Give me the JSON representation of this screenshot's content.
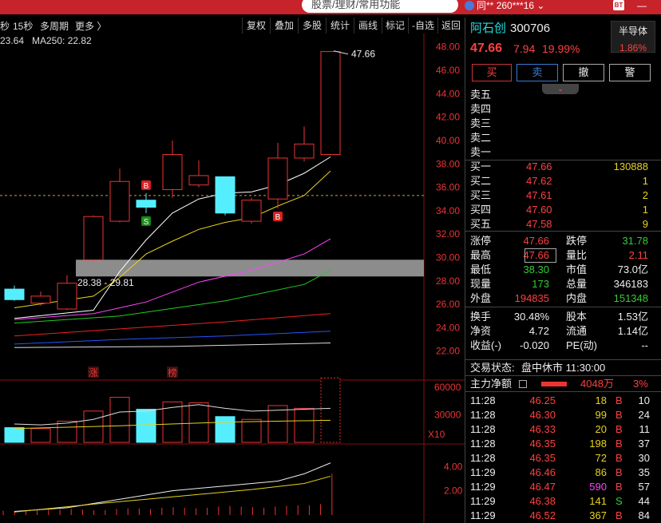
{
  "topbar": {
    "search_placeholder": "股票/理财/常用功能",
    "user": "同**",
    "account": "260***16",
    "bt": "BT",
    "win_min": "—",
    "win_close": "✕"
  },
  "toolbar": {
    "period_fast": "秒",
    "period_15s": "15秒",
    "multi_period": "多周期",
    "more": "更多 〉",
    "buttons": [
      "复权",
      "叠加",
      "多股",
      "统计",
      "画线",
      "标记",
      "-自选",
      "返回"
    ],
    "ma_left": "23.64",
    "ma250": "MA250: 22.82"
  },
  "chart_data": {
    "type": "candlestick",
    "y_ticks": [
      "48.00",
      "46.00",
      "44.00",
      "42.00",
      "40.00",
      "38.00",
      "36.00",
      "34.00",
      "32.00",
      "30.00",
      "28.00",
      "26.00",
      "24.00",
      "22.00"
    ],
    "ylim": [
      21.3,
      48.8
    ],
    "high_label": "47.66",
    "gap_label": "28.38 - 29.81",
    "gap": [
      28.38,
      29.81
    ],
    "ref_line": 35.3,
    "candles": [
      {
        "o": 26.4,
        "c": 27.3,
        "h": 27.6,
        "l": 26.3,
        "t": "down"
      },
      {
        "o": 26.1,
        "c": 26.7,
        "h": 27.1,
        "l": 25.9,
        "t": "up"
      },
      {
        "o": 25.6,
        "c": 27.8,
        "h": 28.5,
        "l": 25.5,
        "t": "up"
      },
      {
        "o": 29.8,
        "c": 33.5,
        "h": 33.6,
        "l": 29.7,
        "t": "up"
      },
      {
        "o": 33.1,
        "c": 36.5,
        "h": 37.6,
        "l": 33.0,
        "t": "up"
      },
      {
        "o": 34.9,
        "c": 34.3,
        "h": 35.5,
        "l": 33.8,
        "t": "down"
      },
      {
        "o": 35.8,
        "c": 38.8,
        "h": 40.0,
        "l": 35.1,
        "t": "up"
      },
      {
        "o": 36.2,
        "c": 37.0,
        "h": 38.3,
        "l": 36.0,
        "t": "up"
      },
      {
        "o": 36.9,
        "c": 33.8,
        "h": 36.9,
        "l": 33.6,
        "t": "down"
      },
      {
        "o": 33.1,
        "c": 34.9,
        "h": 35.1,
        "l": 32.9,
        "t": "up"
      },
      {
        "o": 35.0,
        "c": 38.5,
        "h": 39.8,
        "l": 34.2,
        "t": "up"
      },
      {
        "o": 38.5,
        "c": 39.7,
        "h": 41.2,
        "l": 38.2,
        "t": "up"
      },
      {
        "o": 38.8,
        "c": 47.6,
        "h": 47.66,
        "l": 38.8,
        "t": "up"
      }
    ],
    "markers": [
      {
        "i": 5,
        "label": "B",
        "pos": "above",
        "color": "#d82020"
      },
      {
        "i": 5,
        "label": "S",
        "pos": "below",
        "color": "#1a8a1a"
      },
      {
        "i": 10,
        "label": "B",
        "pos": "below",
        "color": "#d82020"
      }
    ],
    "events": [
      {
        "i": 3,
        "label": "涨"
      },
      {
        "i": 6,
        "label": "榜"
      }
    ],
    "volume": {
      "ticks": [
        "60000",
        "30000"
      ],
      "unit": "X10",
      "max": 66000,
      "values": [
        16000,
        15000,
        23000,
        34000,
        49000,
        36000,
        44000,
        43000,
        28000,
        25000,
        40000,
        37000,
        70000
      ]
    },
    "indicator": {
      "ticks": [
        "4.00",
        "2.00"
      ],
      "max": 5.6
    }
  },
  "stock": {
    "name": "阿石创",
    "code": "300706",
    "sector": "半导体",
    "sector_chg": "1.86%",
    "price": "47.66",
    "change": "7.94",
    "pct": "19.99%"
  },
  "trade_buttons": [
    "买",
    "卖",
    "撤",
    "警"
  ],
  "orderbook": {
    "sell": [
      {
        "label": "卖五",
        "price": "",
        "vol": ""
      },
      {
        "label": "卖四",
        "price": "",
        "vol": ""
      },
      {
        "label": "卖三",
        "price": "",
        "vol": ""
      },
      {
        "label": "卖二",
        "price": "",
        "vol": ""
      },
      {
        "label": "卖一",
        "price": "",
        "vol": ""
      }
    ],
    "buy": [
      {
        "label": "买一",
        "price": "47.66",
        "vol": "130888"
      },
      {
        "label": "买二",
        "price": "47.62",
        "vol": "1"
      },
      {
        "label": "买三",
        "price": "47.61",
        "vol": "2"
      },
      {
        "label": "买四",
        "price": "47.60",
        "vol": "1"
      },
      {
        "label": "买五",
        "price": "47.58",
        "vol": "9"
      }
    ]
  },
  "stats": {
    "涨停": "47.66",
    "跌停": "31.78",
    "最高": "47.66",
    "量比": "2.11",
    "最低": "38.30",
    "市值": "73.0亿",
    "现量": "173",
    "总量": "346183",
    "外盘": "194835",
    "内盘": "151348",
    "换手": "30.48%",
    "股本": "1.53亿",
    "净资": "4.72",
    "流通": "1.14亿",
    "收益(-)": "-0.020",
    "PE(动)": "--"
  },
  "status": {
    "label": "交易状态:",
    "value": "盘中休市 11:30:00"
  },
  "netflow": {
    "label": "主力净额",
    "value": "4048万",
    "pct": "3%"
  },
  "ticks": [
    {
      "t": "11:28",
      "p": "46.25",
      "v": "18",
      "s": "B",
      "n": "10"
    },
    {
      "t": "11:28",
      "p": "46.30",
      "v": "99",
      "s": "B",
      "n": "24"
    },
    {
      "t": "11:28",
      "p": "46.33",
      "v": "20",
      "s": "B",
      "n": "11"
    },
    {
      "t": "11:28",
      "p": "46.35",
      "v": "198",
      "s": "B",
      "n": "37"
    },
    {
      "t": "11:28",
      "p": "46.35",
      "v": "72",
      "s": "B",
      "n": "30"
    },
    {
      "t": "11:29",
      "p": "46.46",
      "v": "86",
      "s": "B",
      "n": "35"
    },
    {
      "t": "11:29",
      "p": "46.47",
      "v": "590",
      "s": "B",
      "n": "57"
    },
    {
      "t": "11:29",
      "p": "46.38",
      "v": "141",
      "s": "S",
      "n": "44"
    },
    {
      "t": "11:29",
      "p": "46.52",
      "v": "367",
      "s": "B",
      "n": "84"
    }
  ]
}
